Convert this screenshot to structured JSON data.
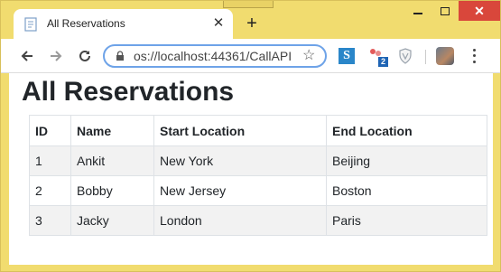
{
  "browser": {
    "tab_title": "All Reservations",
    "tab_close": "✕",
    "new_tab": "+",
    "url": "os://localhost:44361/CallAPI",
    "extension_badge": "2",
    "extension_s_label": "S"
  },
  "page": {
    "heading": "All Reservations",
    "columns": [
      "ID",
      "Name",
      "Start Location",
      "End Location"
    ],
    "rows": [
      [
        "1",
        "Ankit",
        "New York",
        "Beijing"
      ],
      [
        "2",
        "Bobby",
        "New Jersey",
        "Boston"
      ],
      [
        "3",
        "Jacky",
        "London",
        "Paris"
      ]
    ]
  },
  "colors": {
    "window_frame": "#f1dc6f",
    "close_button": "#d9473b",
    "omnibox_focus": "#6ea3e8",
    "table_stripe": "#f2f2f2"
  }
}
